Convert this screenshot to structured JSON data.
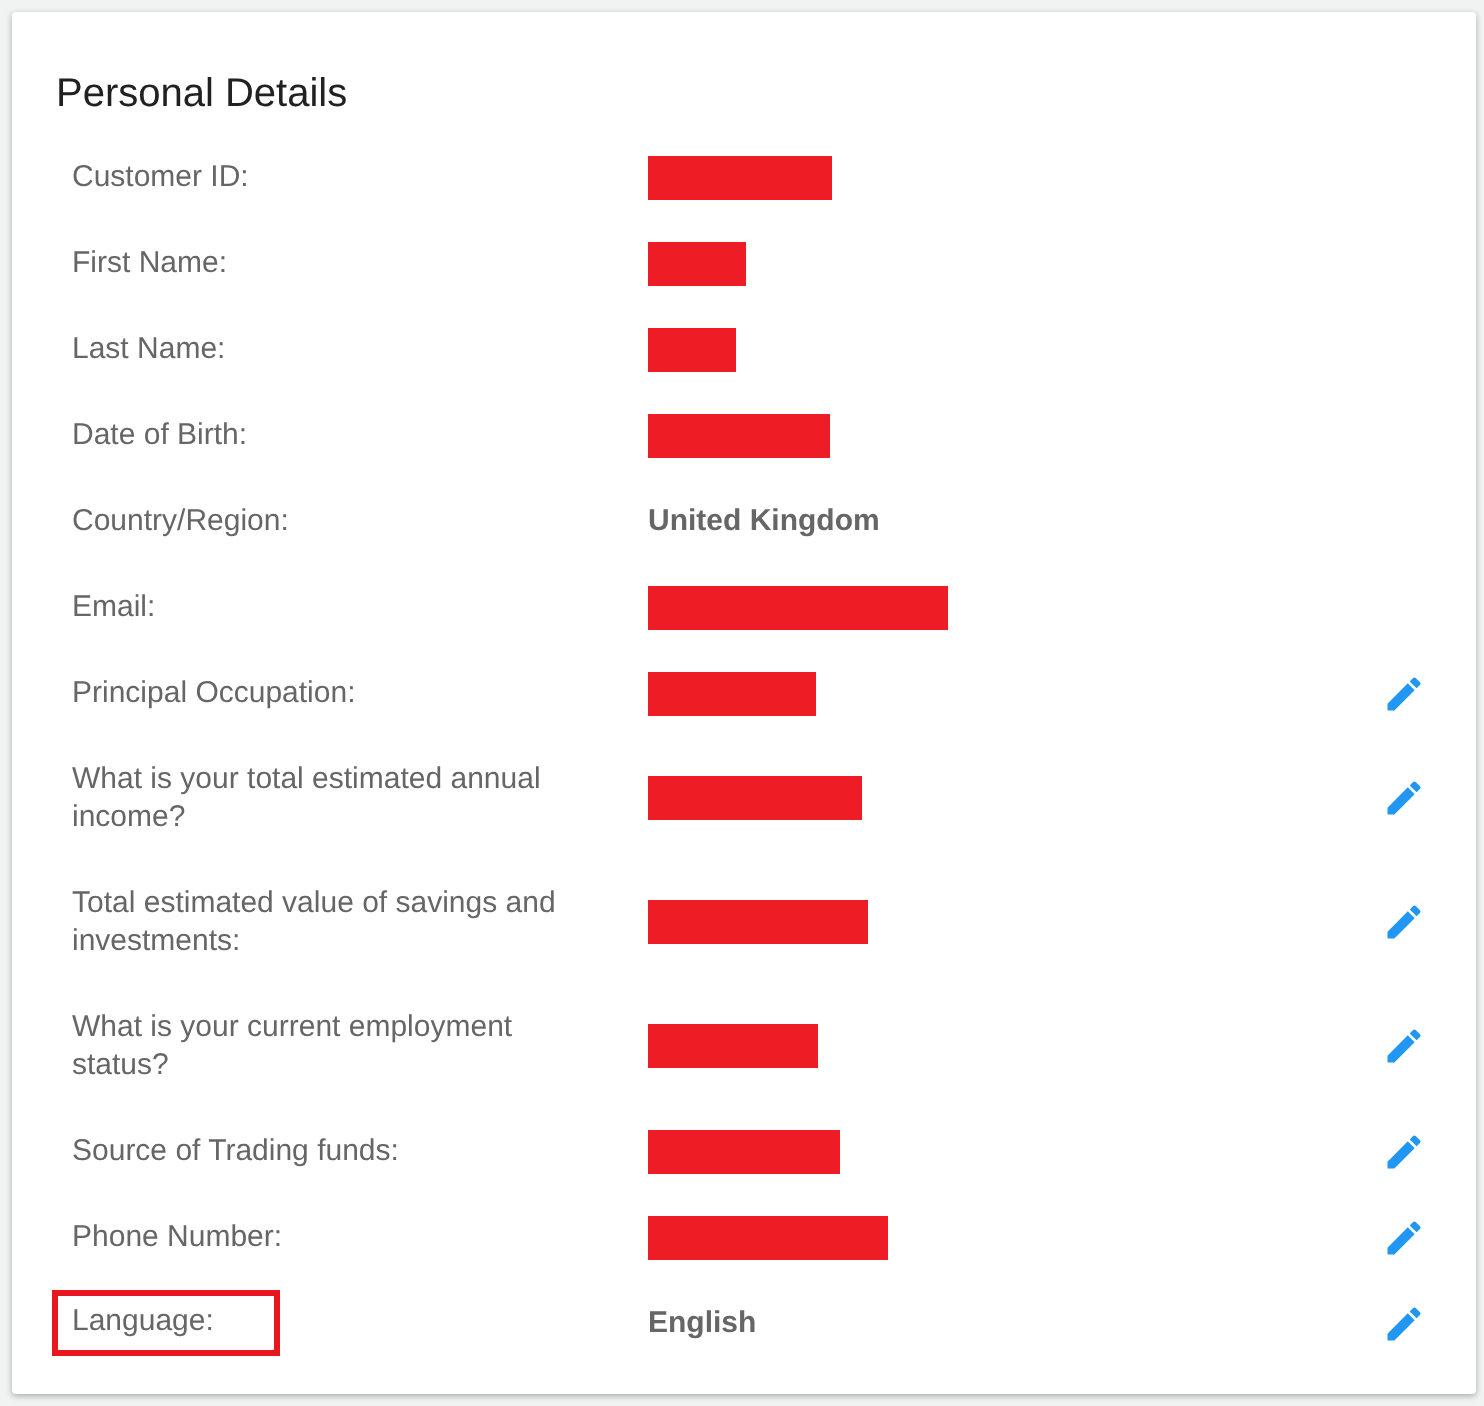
{
  "card": {
    "title": "Personal Details",
    "rows": [
      {
        "label": "Customer ID:",
        "kind": "redacted",
        "editable": false,
        "highlighted": false
      },
      {
        "label": "First Name:",
        "kind": "redacted",
        "editable": false,
        "highlighted": false
      },
      {
        "label": "Last Name:",
        "kind": "redacted",
        "editable": false,
        "highlighted": false
      },
      {
        "label": "Date of Birth:",
        "kind": "redacted",
        "editable": false,
        "highlighted": false
      },
      {
        "label": "Country/Region:",
        "kind": "text",
        "value": "United Kingdom",
        "editable": false,
        "highlighted": false
      },
      {
        "label": "Email:",
        "kind": "redacted",
        "editable": false,
        "highlighted": false
      },
      {
        "label": "Principal Occupation:",
        "kind": "redacted",
        "editable": true,
        "highlighted": false
      },
      {
        "label": "What is your total estimated annual income?",
        "kind": "redacted",
        "editable": true,
        "highlighted": false
      },
      {
        "label": "Total estimated value of savings and investments:",
        "kind": "redacted",
        "editable": true,
        "highlighted": false
      },
      {
        "label": "What is your current employment status?",
        "kind": "redacted",
        "editable": true,
        "highlighted": false
      },
      {
        "label": "Source of Trading funds:",
        "kind": "redacted",
        "editable": true,
        "highlighted": false
      },
      {
        "label": "Phone Number:",
        "kind": "redacted",
        "editable": true,
        "highlighted": false
      },
      {
        "label": "Language:",
        "kind": "text",
        "value": "English",
        "editable": true,
        "highlighted": true
      }
    ]
  }
}
